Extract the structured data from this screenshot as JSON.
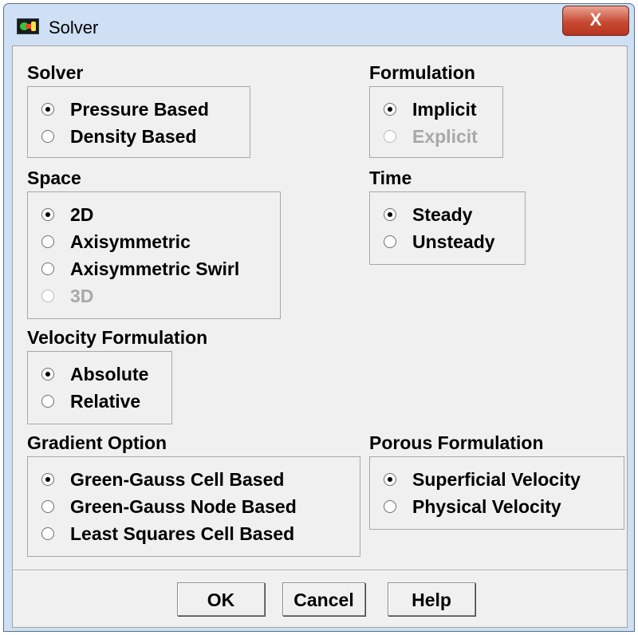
{
  "window": {
    "title": "Solver",
    "close_label": "X"
  },
  "groups": {
    "solver": {
      "label": "Solver",
      "options": [
        {
          "label": "Pressure Based",
          "selected": true,
          "enabled": true
        },
        {
          "label": "Density Based",
          "selected": false,
          "enabled": true
        }
      ]
    },
    "formulation": {
      "label": "Formulation",
      "options": [
        {
          "label": "Implicit",
          "selected": true,
          "enabled": true
        },
        {
          "label": "Explicit",
          "selected": false,
          "enabled": false
        }
      ]
    },
    "space": {
      "label": "Space",
      "options": [
        {
          "label": "2D",
          "selected": true,
          "enabled": true
        },
        {
          "label": "Axisymmetric",
          "selected": false,
          "enabled": true
        },
        {
          "label": "Axisymmetric Swirl",
          "selected": false,
          "enabled": true
        },
        {
          "label": "3D",
          "selected": false,
          "enabled": false
        }
      ]
    },
    "time": {
      "label": "Time",
      "options": [
        {
          "label": "Steady",
          "selected": true,
          "enabled": true
        },
        {
          "label": "Unsteady",
          "selected": false,
          "enabled": true
        }
      ]
    },
    "velocity": {
      "label": "Velocity Formulation",
      "options": [
        {
          "label": "Absolute",
          "selected": true,
          "enabled": true
        },
        {
          "label": "Relative",
          "selected": false,
          "enabled": true
        }
      ]
    },
    "gradient": {
      "label": "Gradient Option",
      "options": [
        {
          "label": "Green-Gauss Cell Based",
          "selected": true,
          "enabled": true
        },
        {
          "label": "Green-Gauss Node Based",
          "selected": false,
          "enabled": true
        },
        {
          "label": "Least Squares Cell Based",
          "selected": false,
          "enabled": true
        }
      ]
    },
    "porous": {
      "label": "Porous Formulation",
      "options": [
        {
          "label": "Superficial Velocity",
          "selected": true,
          "enabled": true
        },
        {
          "label": "Physical Velocity",
          "selected": false,
          "enabled": true
        }
      ]
    }
  },
  "buttons": {
    "ok": "OK",
    "cancel": "Cancel",
    "help": "Help"
  },
  "colors": {
    "close_button": "#c74a33",
    "window_frame": "#cfe0f4",
    "dialog_bg": "#f0f0f0",
    "disabled_text": "#a8a8a8"
  }
}
